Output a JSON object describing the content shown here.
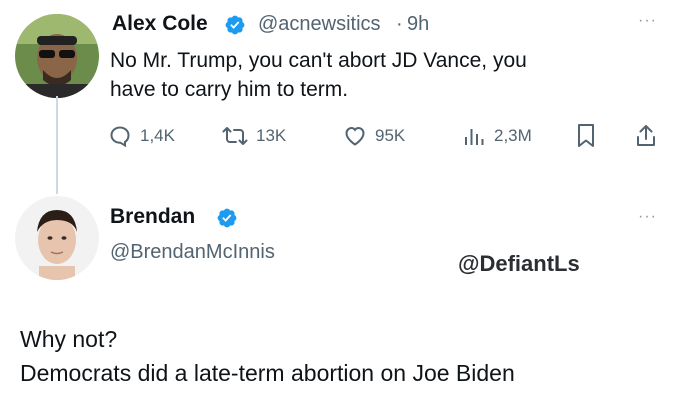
{
  "tweet": {
    "author_name": "Alex Cole",
    "handle": "@acnewsitics",
    "separator": "·",
    "time": "9h",
    "more_label": "···",
    "text_line1": "No Mr. Trump, you can't abort JD Vance, you",
    "text_line2": "have to carry him to term.",
    "actions": {
      "replies": "1,4K",
      "reposts": "13K",
      "likes": "95K",
      "views": "2,3M"
    }
  },
  "reply": {
    "author_name": "Brendan",
    "handle": "@BrendanMcInnis",
    "more_label": "···",
    "text_line1": "Why not?",
    "text_line2": "Democrats did a late-term abortion on Joe Biden"
  },
  "watermark": "@DefiantLs",
  "colors": {
    "verified": "#1d9bf0",
    "text": "#0f1419",
    "secondary": "#536471",
    "thread_line": "#cfd9de"
  }
}
